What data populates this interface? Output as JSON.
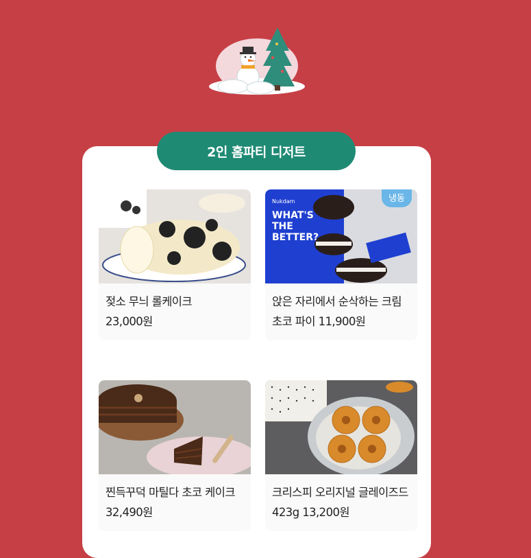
{
  "section": {
    "title": "2인 홈파티 디저트"
  },
  "products": [
    {
      "name": "젖소 무늬 롤케이크",
      "price": "23,000원"
    },
    {
      "name": "앉은 자리에서 순삭하는 크림 초코 파이",
      "price": "11,900원",
      "badge": "냉동",
      "package_text": [
        "WHAT'S",
        "THE",
        "BETTER?"
      ],
      "brand": "Nukdam"
    },
    {
      "name": "찐득꾸덕 마틸다 초코 케이크",
      "price": "32,490원"
    },
    {
      "name": "크리스피 오리지널 글레이즈드 423g",
      "price": "13,200원"
    }
  ],
  "colors": {
    "background": "#c63f45",
    "accent": "#1f8a74",
    "badge": "#6ab6e8"
  }
}
